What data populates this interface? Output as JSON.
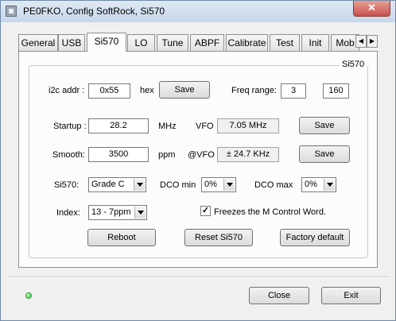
{
  "window": {
    "title": "PE0FKO, Config SoftRock, Si570",
    "close_glyph": "✕"
  },
  "tabs": [
    {
      "label": "General"
    },
    {
      "label": "USB"
    },
    {
      "label": "Si570"
    },
    {
      "label": "LO"
    },
    {
      "label": "Tune"
    },
    {
      "label": "ABPF"
    },
    {
      "label": "Calibrate"
    },
    {
      "label": "Test"
    },
    {
      "label": "Init"
    },
    {
      "label": "Mob"
    }
  ],
  "tab_scroll": {
    "left": "◀",
    "right": "▶"
  },
  "group": {
    "label": "Si570"
  },
  "i2c": {
    "label": "i2c addr :",
    "value": "0x55",
    "unit": "hex",
    "save_label": "Save"
  },
  "freq_range": {
    "label": "Freq range:",
    "min": "3",
    "max": "160"
  },
  "startup": {
    "label": "Startup :",
    "value": "28.2",
    "unit": "MHz",
    "vfo_label": "VFO",
    "vfo_value": "7.05 MHz",
    "save_label": "Save"
  },
  "smooth": {
    "label": "Smooth:",
    "value": "3500",
    "unit": "ppm",
    "vfo_label": "@VFO",
    "vfo_value": "± 24.7 KHz",
    "save_label": "Save"
  },
  "si570": {
    "label": "Si570:",
    "grade": "Grade C",
    "dco_min_label": "DCO min",
    "dco_min": "0%",
    "dco_max_label": "DCO max",
    "dco_max": "0%"
  },
  "index": {
    "label": "Index:",
    "value": "13 - 7ppm"
  },
  "freeze": {
    "label": "Freezes the M Control Word.",
    "checked": true,
    "mark": "✓"
  },
  "actions": {
    "reboot": "Reboot",
    "reset": "Reset Si570",
    "factory": "Factory default"
  },
  "footer": {
    "close": "Close",
    "exit": "Exit",
    "status_led_color": "#22c322"
  }
}
